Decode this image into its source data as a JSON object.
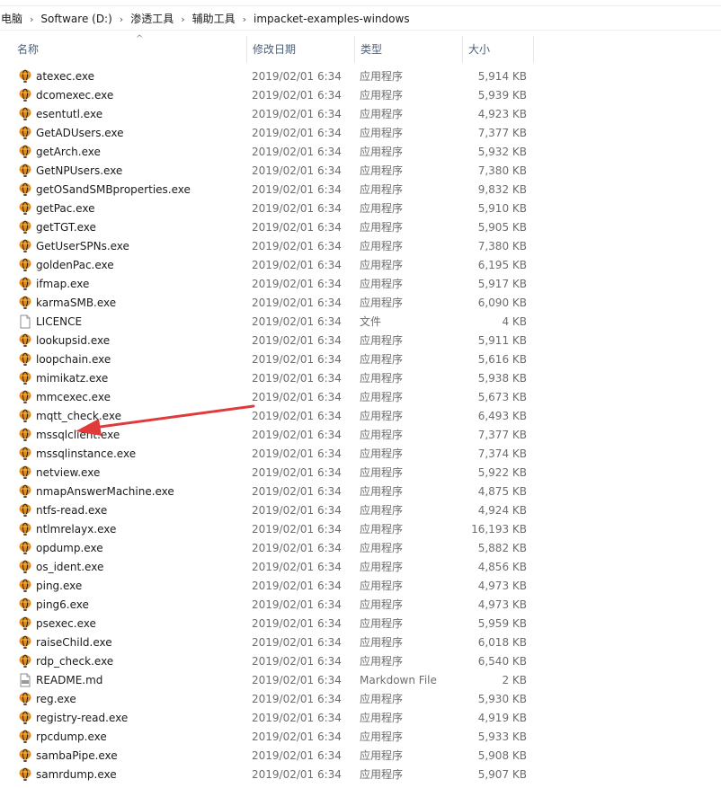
{
  "breadcrumb": [
    "电脑",
    "Software (D:)",
    "渗透工具",
    "辅助工具",
    "impacket-examples-windows"
  ],
  "columns": {
    "name": "名称",
    "date": "修改日期",
    "type": "类型",
    "size": "大小"
  },
  "sort_indicator": "^",
  "colors": {
    "header_text": "#4c607a",
    "annotation_arrow": "#e03a3a"
  },
  "files": [
    {
      "name": "atexec.exe",
      "date": "2019/02/01 6:34",
      "type": "应用程序",
      "size": "5,914 KB",
      "icon": "balloon-exe-icon"
    },
    {
      "name": "dcomexec.exe",
      "date": "2019/02/01 6:34",
      "type": "应用程序",
      "size": "5,939 KB",
      "icon": "balloon-exe-icon"
    },
    {
      "name": "esentutl.exe",
      "date": "2019/02/01 6:34",
      "type": "应用程序",
      "size": "4,923 KB",
      "icon": "balloon-exe-icon"
    },
    {
      "name": "GetADUsers.exe",
      "date": "2019/02/01 6:34",
      "type": "应用程序",
      "size": "7,377 KB",
      "icon": "balloon-exe-icon"
    },
    {
      "name": "getArch.exe",
      "date": "2019/02/01 6:34",
      "type": "应用程序",
      "size": "5,932 KB",
      "icon": "balloon-exe-icon"
    },
    {
      "name": "GetNPUsers.exe",
      "date": "2019/02/01 6:34",
      "type": "应用程序",
      "size": "7,380 KB",
      "icon": "balloon-exe-icon"
    },
    {
      "name": "getOSandSMBproperties.exe",
      "date": "2019/02/01 6:34",
      "type": "应用程序",
      "size": "9,832 KB",
      "icon": "balloon-exe-icon"
    },
    {
      "name": "getPac.exe",
      "date": "2019/02/01 6:34",
      "type": "应用程序",
      "size": "5,910 KB",
      "icon": "balloon-exe-icon"
    },
    {
      "name": "getTGT.exe",
      "date": "2019/02/01 6:34",
      "type": "应用程序",
      "size": "5,905 KB",
      "icon": "balloon-exe-icon"
    },
    {
      "name": "GetUserSPNs.exe",
      "date": "2019/02/01 6:34",
      "type": "应用程序",
      "size": "7,380 KB",
      "icon": "balloon-exe-icon"
    },
    {
      "name": "goldenPac.exe",
      "date": "2019/02/01 6:34",
      "type": "应用程序",
      "size": "6,195 KB",
      "icon": "balloon-exe-icon"
    },
    {
      "name": "ifmap.exe",
      "date": "2019/02/01 6:34",
      "type": "应用程序",
      "size": "5,917 KB",
      "icon": "balloon-exe-icon"
    },
    {
      "name": "karmaSMB.exe",
      "date": "2019/02/01 6:34",
      "type": "应用程序",
      "size": "6,090 KB",
      "icon": "balloon-exe-icon"
    },
    {
      "name": "LICENCE",
      "date": "2019/02/01 6:34",
      "type": "文件",
      "size": "4 KB",
      "icon": "blank-file-icon"
    },
    {
      "name": "lookupsid.exe",
      "date": "2019/02/01 6:34",
      "type": "应用程序",
      "size": "5,911 KB",
      "icon": "balloon-exe-icon"
    },
    {
      "name": "loopchain.exe",
      "date": "2019/02/01 6:34",
      "type": "应用程序",
      "size": "5,616 KB",
      "icon": "balloon-exe-icon"
    },
    {
      "name": "mimikatz.exe",
      "date": "2019/02/01 6:34",
      "type": "应用程序",
      "size": "5,938 KB",
      "icon": "balloon-exe-icon"
    },
    {
      "name": "mmcexec.exe",
      "date": "2019/02/01 6:34",
      "type": "应用程序",
      "size": "5,673 KB",
      "icon": "balloon-exe-icon"
    },
    {
      "name": "mqtt_check.exe",
      "date": "2019/02/01 6:34",
      "type": "应用程序",
      "size": "6,493 KB",
      "icon": "balloon-exe-icon"
    },
    {
      "name": "mssqlclient.exe",
      "date": "2019/02/01 6:34",
      "type": "应用程序",
      "size": "7,377 KB",
      "icon": "balloon-exe-icon"
    },
    {
      "name": "mssqlinstance.exe",
      "date": "2019/02/01 6:34",
      "type": "应用程序",
      "size": "7,374 KB",
      "icon": "balloon-exe-icon"
    },
    {
      "name": "netview.exe",
      "date": "2019/02/01 6:34",
      "type": "应用程序",
      "size": "5,922 KB",
      "icon": "balloon-exe-icon"
    },
    {
      "name": "nmapAnswerMachine.exe",
      "date": "2019/02/01 6:34",
      "type": "应用程序",
      "size": "4,875 KB",
      "icon": "balloon-exe-icon"
    },
    {
      "name": "ntfs-read.exe",
      "date": "2019/02/01 6:34",
      "type": "应用程序",
      "size": "4,924 KB",
      "icon": "balloon-exe-icon"
    },
    {
      "name": "ntlmrelayx.exe",
      "date": "2019/02/01 6:34",
      "type": "应用程序",
      "size": "16,193 KB",
      "icon": "balloon-exe-icon"
    },
    {
      "name": "opdump.exe",
      "date": "2019/02/01 6:34",
      "type": "应用程序",
      "size": "5,882 KB",
      "icon": "balloon-exe-icon"
    },
    {
      "name": "os_ident.exe",
      "date": "2019/02/01 6:34",
      "type": "应用程序",
      "size": "4,856 KB",
      "icon": "balloon-exe-icon"
    },
    {
      "name": "ping.exe",
      "date": "2019/02/01 6:34",
      "type": "应用程序",
      "size": "4,973 KB",
      "icon": "balloon-exe-icon"
    },
    {
      "name": "ping6.exe",
      "date": "2019/02/01 6:34",
      "type": "应用程序",
      "size": "4,973 KB",
      "icon": "balloon-exe-icon"
    },
    {
      "name": "psexec.exe",
      "date": "2019/02/01 6:34",
      "type": "应用程序",
      "size": "5,959 KB",
      "icon": "balloon-exe-icon"
    },
    {
      "name": "raiseChild.exe",
      "date": "2019/02/01 6:34",
      "type": "应用程序",
      "size": "6,018 KB",
      "icon": "balloon-exe-icon"
    },
    {
      "name": "rdp_check.exe",
      "date": "2019/02/01 6:34",
      "type": "应用程序",
      "size": "6,540 KB",
      "icon": "balloon-exe-icon"
    },
    {
      "name": "README.md",
      "date": "2019/02/01 6:34",
      "type": "Markdown File",
      "size": "2 KB",
      "icon": "markdown-file-icon"
    },
    {
      "name": "reg.exe",
      "date": "2019/02/01 6:34",
      "type": "应用程序",
      "size": "5,930 KB",
      "icon": "balloon-exe-icon"
    },
    {
      "name": "registry-read.exe",
      "date": "2019/02/01 6:34",
      "type": "应用程序",
      "size": "4,919 KB",
      "icon": "balloon-exe-icon"
    },
    {
      "name": "rpcdump.exe",
      "date": "2019/02/01 6:34",
      "type": "应用程序",
      "size": "5,933 KB",
      "icon": "balloon-exe-icon"
    },
    {
      "name": "sambaPipe.exe",
      "date": "2019/02/01 6:34",
      "type": "应用程序",
      "size": "5,908 KB",
      "icon": "balloon-exe-icon"
    },
    {
      "name": "samrdump.exe",
      "date": "2019/02/01 6:34",
      "type": "应用程序",
      "size": "5,907 KB",
      "icon": "balloon-exe-icon"
    }
  ]
}
